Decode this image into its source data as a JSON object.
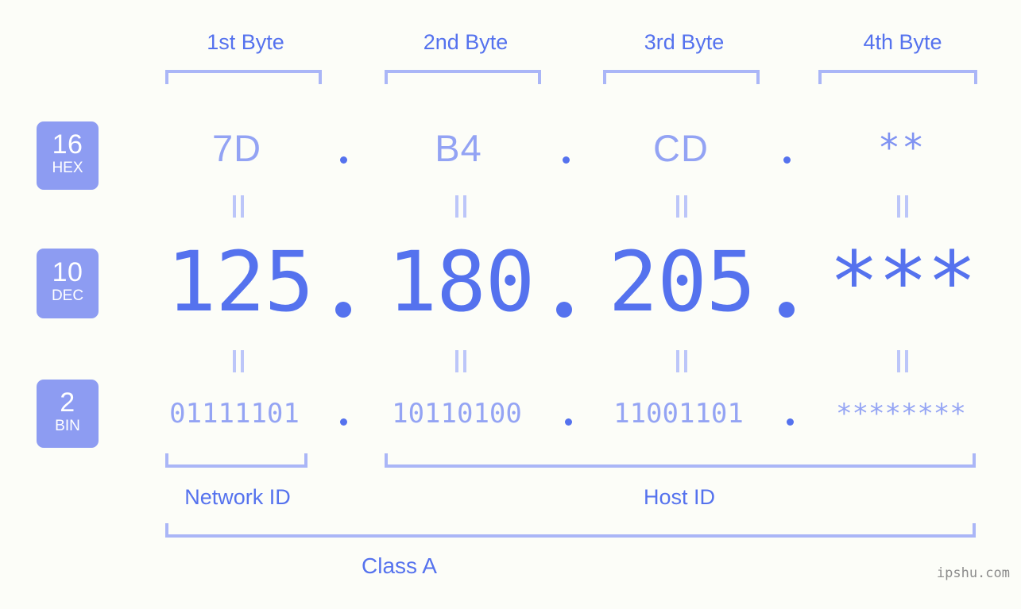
{
  "background_color": "#fcfdf8",
  "accent_color": "#5572ee",
  "accent_light_color": "#93a3f4",
  "bracket_color": "#aab6f7",
  "badge_color": "#8d9cf2",
  "header": {
    "bytes": [
      {
        "label": "1st Byte"
      },
      {
        "label": "2nd Byte"
      },
      {
        "label": "3rd Byte"
      },
      {
        "label": "4th Byte"
      }
    ]
  },
  "rows": [
    {
      "base_number": "16",
      "base_name": "HEX",
      "values": [
        "7D",
        "B4",
        "CD",
        "**"
      ],
      "separator": "."
    },
    {
      "base_number": "10",
      "base_name": "DEC",
      "values": [
        "125",
        "180",
        "205",
        "***"
      ],
      "separator": "."
    },
    {
      "base_number": "2",
      "base_name": "BIN",
      "values": [
        "01111101",
        "10110100",
        "11001101",
        "********"
      ],
      "separator": "."
    }
  ],
  "connectors": {
    "symbol": "=",
    "count_per_row_gap": 4
  },
  "footer": {
    "network_id_label": "Network ID",
    "host_id_label": "Host ID",
    "class_label": "Class A",
    "watermark": "ipshu.com"
  }
}
